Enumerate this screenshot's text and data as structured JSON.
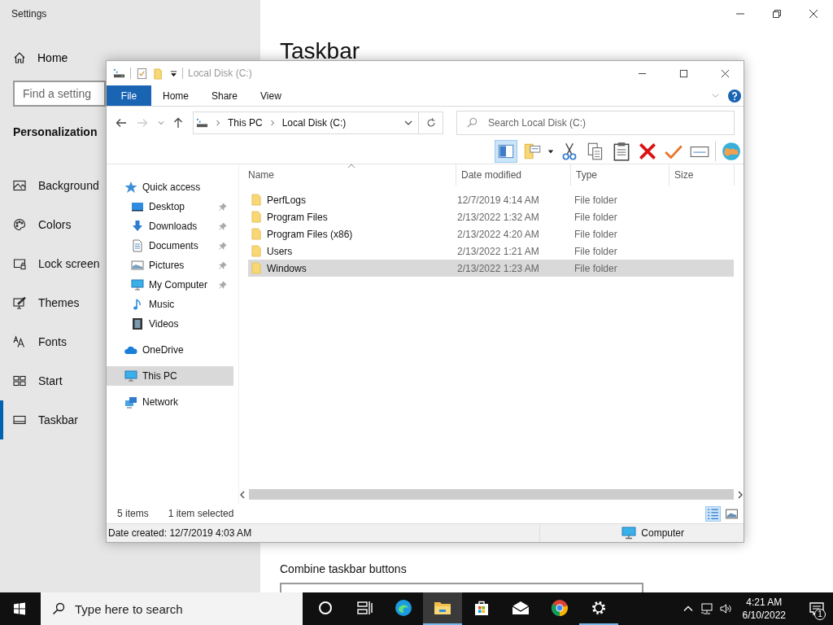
{
  "settings": {
    "title": "Settings",
    "home": "Home",
    "search_placeholder": "Find a setting",
    "section": "Personalization",
    "page_title": "Taskbar",
    "combine_label": "Combine taskbar buttons",
    "nav": [
      {
        "label": "Background",
        "kind": "background",
        "selected": false
      },
      {
        "label": "Colors",
        "kind": "colors",
        "selected": false
      },
      {
        "label": "Lock screen",
        "kind": "lock",
        "selected": false
      },
      {
        "label": "Themes",
        "kind": "themes",
        "selected": false
      },
      {
        "label": "Fonts",
        "kind": "fonts",
        "selected": false
      },
      {
        "label": "Start",
        "kind": "start",
        "selected": false
      },
      {
        "label": "Taskbar",
        "kind": "taskbar",
        "selected": true
      }
    ]
  },
  "explorer": {
    "title": "Local Disk (C:)",
    "ribbon_tabs": [
      {
        "label": "File",
        "kind": "file"
      },
      {
        "label": "Home",
        "kind": "tab"
      },
      {
        "label": "Share",
        "kind": "tab"
      },
      {
        "label": "View",
        "kind": "tab"
      }
    ],
    "breadcrumb": [
      "This PC",
      "Local Disk (C:)"
    ],
    "search_placeholder": "Search Local Disk (C:)",
    "nav": [
      {
        "label": "Quick access",
        "kind": "star",
        "selected": false,
        "children": [
          {
            "label": "Desktop",
            "kind": "desktop",
            "pinned": true,
            "selected": false
          },
          {
            "label": "Downloads",
            "kind": "download",
            "pinned": true,
            "selected": false
          },
          {
            "label": "Documents",
            "kind": "document",
            "pinned": true,
            "selected": false
          },
          {
            "label": "Pictures",
            "kind": "pictures",
            "pinned": true,
            "selected": false
          },
          {
            "label": "My Computer",
            "kind": "computer",
            "pinned": true,
            "selected": false
          },
          {
            "label": "Music",
            "kind": "music",
            "pinned": false,
            "selected": false
          },
          {
            "label": "Videos",
            "kind": "videos",
            "pinned": false,
            "selected": false
          }
        ]
      },
      {
        "label": "OneDrive",
        "kind": "cloud",
        "selected": false
      },
      {
        "label": "This PC",
        "kind": "computer",
        "selected": true
      },
      {
        "label": "Network",
        "kind": "network",
        "selected": false
      }
    ],
    "columns": [
      "Name",
      "Date modified",
      "Type",
      "Size"
    ],
    "rows": [
      {
        "name": "PerfLogs",
        "date": "12/7/2019 4:14 AM",
        "type": "File folder",
        "selected": false
      },
      {
        "name": "Program Files",
        "date": "2/13/2022 1:32 AM",
        "type": "File folder",
        "selected": false
      },
      {
        "name": "Program Files (x86)",
        "date": "2/13/2022 4:20 AM",
        "type": "File folder",
        "selected": false
      },
      {
        "name": "Users",
        "date": "2/13/2022 1:21 AM",
        "type": "File folder",
        "selected": false
      },
      {
        "name": "Windows",
        "date": "2/13/2022 1:23 AM",
        "type": "File folder",
        "selected": true
      }
    ],
    "item_count": "5 items",
    "selection_count": "1 item selected",
    "details": "Date created: 12/7/2019 4:03 AM",
    "location": "Computer"
  },
  "taskbar": {
    "search_placeholder": "Type here to search",
    "apps": [
      {
        "kind": "cortana",
        "running": false,
        "focused": false
      },
      {
        "kind": "taskview",
        "running": false,
        "focused": false
      },
      {
        "kind": "edge",
        "running": false,
        "focused": false
      },
      {
        "kind": "folder",
        "running": true,
        "focused": true
      },
      {
        "kind": "store",
        "running": false,
        "focused": false
      },
      {
        "kind": "mail",
        "running": false,
        "focused": false
      },
      {
        "kind": "chrome",
        "running": false,
        "focused": false
      },
      {
        "kind": "gear",
        "running": true,
        "focused": false
      }
    ],
    "time": "4:21 AM",
    "date": "6/10/2022",
    "notification_count": "1"
  }
}
